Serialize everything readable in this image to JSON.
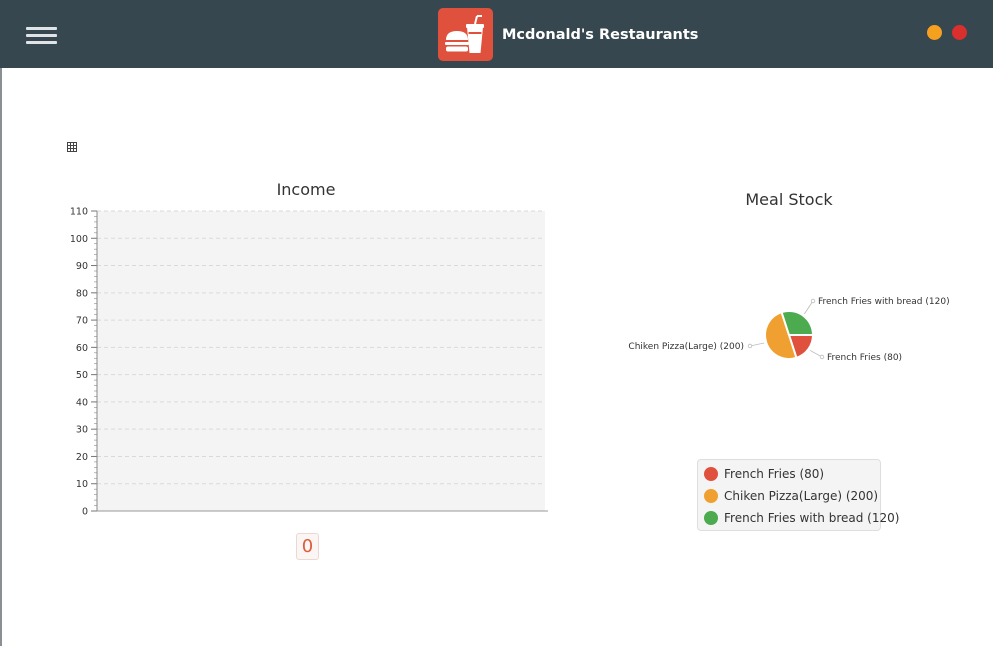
{
  "header": {
    "title": "Mcdonald's Restaurants",
    "menu_icon": "hamburger-menu-icon",
    "logo_icon": "burger-drink-icon",
    "window_buttons": [
      {
        "name": "minimize",
        "color": "#f5a01f"
      },
      {
        "name": "close",
        "color": "#d9302d"
      }
    ]
  },
  "income": {
    "title": "Income",
    "badge_value": "0"
  },
  "meal_stock": {
    "title": "Meal Stock",
    "legend": [
      {
        "label": "French Fries (80)",
        "color": "#e0513d"
      },
      {
        "label": "Chiken Pizza(Large) (200)",
        "color": "#f0a030"
      },
      {
        "label": "French Fries with bread (120)",
        "color": "#4caa4f"
      }
    ]
  },
  "colors": {
    "header_bg": "#37474f",
    "logo_bg": "#e0513d",
    "accent": "#e05a3b"
  },
  "chart_data": [
    {
      "type": "bar",
      "title": "Income",
      "categories": [],
      "values": [],
      "ylim": [
        0,
        110
      ],
      "yticks": [
        0,
        10,
        20,
        30,
        40,
        50,
        60,
        70,
        80,
        90,
        100,
        110
      ],
      "grid": true,
      "xlabel": "",
      "ylabel": ""
    },
    {
      "type": "pie",
      "title": "Meal Stock",
      "categories": [
        "French Fries",
        "Chiken Pizza(Large)",
        "French Fries with bread"
      ],
      "values": [
        80,
        200,
        120
      ],
      "labels": [
        "French Fries (80)",
        "Chiken Pizza(Large) (200)",
        "French Fries with bread (120)"
      ],
      "colors": [
        "#e0513d",
        "#f0a030",
        "#4caa4f"
      ],
      "legend": "bottom"
    }
  ]
}
